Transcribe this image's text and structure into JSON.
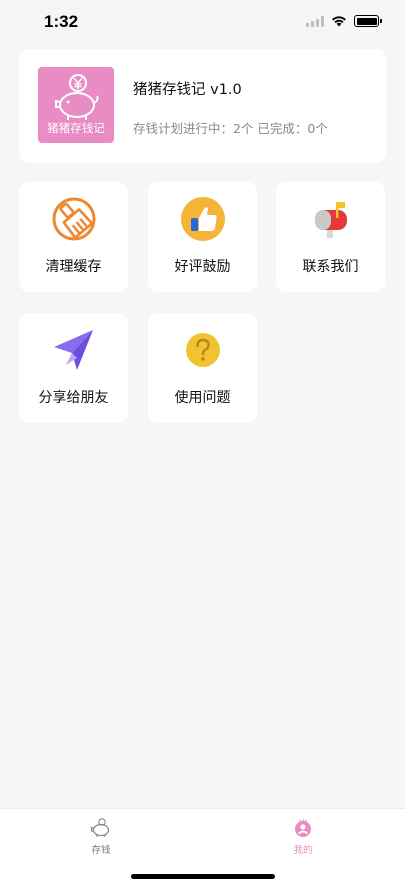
{
  "status_bar": {
    "time": "1:32"
  },
  "profile": {
    "logo_caption": "猪猪存钱记",
    "app_name": "猪猪存钱记  v1.0",
    "plans_summary": "存钱计划进行中：2个   已完成：0个"
  },
  "tiles": [
    {
      "label": "清理缓存",
      "icon": "broom-icon"
    },
    {
      "label": "好评鼓励",
      "icon": "thumbs-up-icon"
    },
    {
      "label": "联系我们",
      "icon": "mailbox-icon"
    },
    {
      "label": "分享给朋友",
      "icon": "paper-plane-icon"
    },
    {
      "label": "使用问题",
      "icon": "question-icon"
    }
  ],
  "tab_bar": {
    "tabs": [
      {
        "label": "存钱",
        "icon": "piggy-bank-icon",
        "active": false
      },
      {
        "label": "我的",
        "icon": "profile-icon",
        "active": true
      }
    ]
  },
  "colors": {
    "background": "#f6f6f6",
    "accent_pink": "#e88cc3",
    "orange": "#f0862e",
    "purple": "#8a6cf0",
    "gold": "#f2c230"
  }
}
